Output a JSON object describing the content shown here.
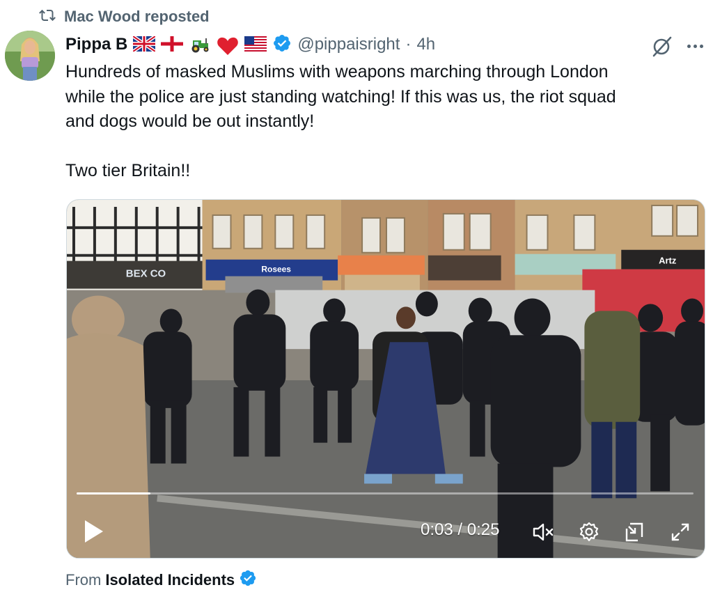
{
  "repost": {
    "label": "Mac Wood reposted"
  },
  "post": {
    "author": {
      "display_name": "Pippa B",
      "emojis": [
        "uk-flag",
        "england-flag",
        "tractor",
        "red-heart",
        "us-flag"
      ],
      "handle": "@pippaisright",
      "separator": "·",
      "time": "4h"
    },
    "text": {
      "line1": "Hundreds of masked Muslims with weapons marching through London",
      "line2": "while the police are just standing watching! If this was us, the riot squad",
      "line3": "and dogs would be out instantly!",
      "line4": "Two tier Britain!!"
    }
  },
  "video": {
    "current_time": "0:03",
    "time_separator": "/",
    "duration": "0:25",
    "progress_fraction": 0.12,
    "shop_signs": [
      "BEX CO",
      "Rosees",
      "Artz"
    ],
    "controls": [
      "play-icon",
      "mute-icon",
      "settings-icon",
      "picture-in-picture-icon",
      "fullscreen-icon"
    ]
  },
  "source": {
    "prefix": "From",
    "name": "Isolated Incidents"
  },
  "colors": {
    "accent_blue": "#1d9bf0",
    "muted_text": "#536471",
    "text": "#0f1419"
  }
}
